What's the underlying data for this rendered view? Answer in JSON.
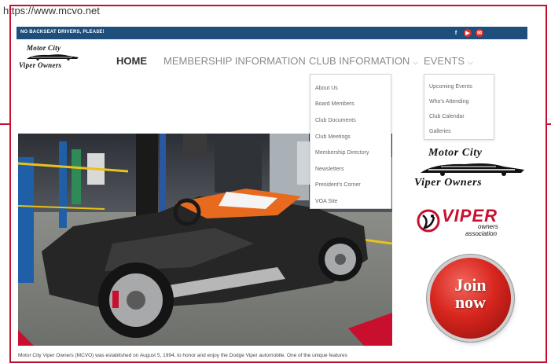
{
  "browser": {
    "url": "https://www.mcvo.net"
  },
  "topbar": {
    "tagline": "NO BACKSEAT DRIVERS, PLEASE!",
    "social": [
      {
        "icon": "facebook-icon",
        "glyph": "f"
      },
      {
        "icon": "youtube-icon",
        "glyph": "▶"
      },
      {
        "icon": "email-icon",
        "glyph": "✉"
      }
    ]
  },
  "logo": {
    "line1": "Motor City",
    "line2": "Viper Owners"
  },
  "nav": {
    "home": "HOME",
    "membership": "MEMBERSHIP INFORMATION",
    "club": "CLUB INFORMATION",
    "events": "EVENTS",
    "chevron": "⌵"
  },
  "club_dropdown": [
    "About Us",
    "Board Members",
    "Club Documents",
    "Club Meetings",
    "Membership Directory",
    "Newsletters",
    "President's Corner",
    "VOA Site"
  ],
  "events_dropdown": [
    "Upcoming Events",
    "Who's Attending",
    "Club Calendar",
    "Galleries"
  ],
  "sidebar": {
    "mcvo_line1": "Motor City",
    "mcvo_line2": "Viper Owners",
    "voa_word": "VIPER",
    "voa_sub1": "owners",
    "voa_sub2": "association",
    "join_line1": "Join",
    "join_line2": "now"
  },
  "intro_text": "Motor City Viper Owners (MCVO) was established on August 5, 1994, to honor and enjoy the Dodge Viper automobile. One of the unique features",
  "colors": {
    "accent_red": "#c8102e",
    "topbar_blue": "#1d4e7c"
  }
}
